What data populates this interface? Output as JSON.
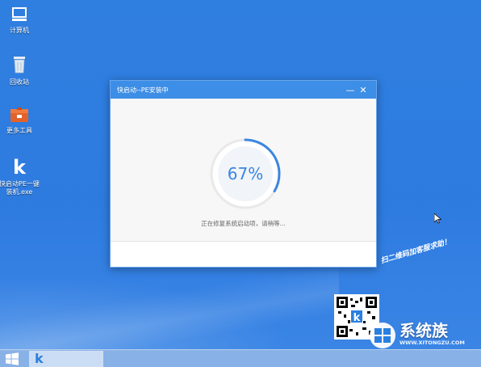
{
  "desktop": {
    "icons": [
      {
        "label": "计算机",
        "icon": "computer-icon"
      },
      {
        "label": "回收站",
        "icon": "recycle-bin-icon"
      },
      {
        "label": "更多工具",
        "icon": "toolbox-icon"
      },
      {
        "label": "快启动PE一键装机.exe",
        "icon": "kqd-app-icon"
      }
    ]
  },
  "window": {
    "title": "快启动--PE安装中",
    "progress_text": "67%",
    "progress": 0.67,
    "status": "正在修复系统启动项，请稍等...",
    "minimize": "—",
    "close": "✕"
  },
  "promo": {
    "text": "扫二维码加客服求助！"
  },
  "brand": {
    "name": "系统族",
    "url": "WWW.XITONGZU.COM"
  },
  "taskbar": {
    "start_icon": "windows-start-icon",
    "app_glyph": "k"
  },
  "colors": {
    "desktop": "#2f7fe0",
    "titlebar": "#3d8ee6",
    "progress": "#3a86e0"
  }
}
